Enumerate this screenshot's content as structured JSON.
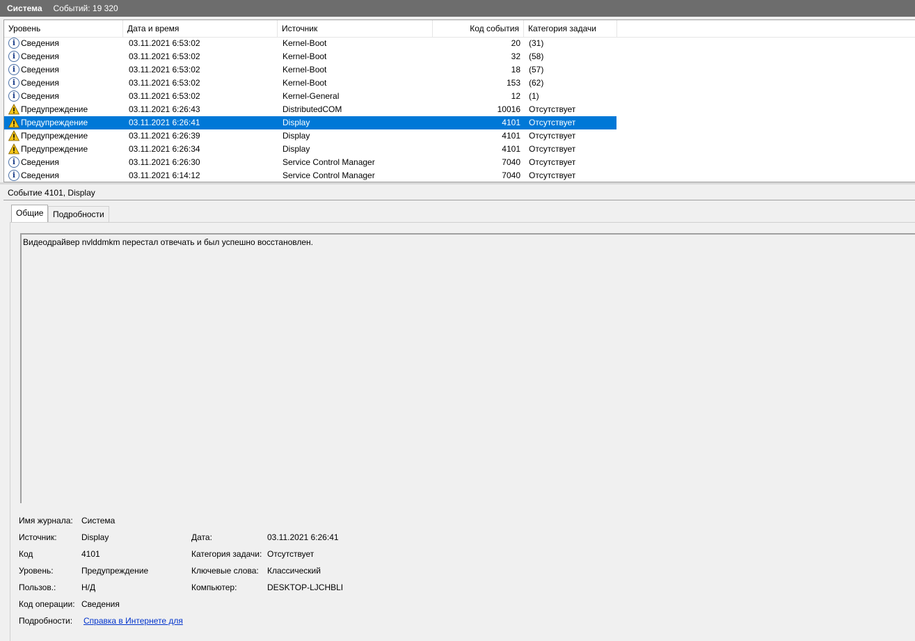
{
  "titlebar": {
    "log_name": "Система",
    "event_count": "Событий: 19 320"
  },
  "columns": {
    "level": "Уровень",
    "datetime": "Дата и время",
    "source": "Источник",
    "event_code": "Код события",
    "task_category": "Категория задачи"
  },
  "events": [
    {
      "level": "Сведения",
      "icon": "info-icon",
      "datetime": "03.11.2021 6:53:02",
      "source": "Kernel-Boot",
      "code": "20",
      "category": "(31)"
    },
    {
      "level": "Сведения",
      "icon": "info-icon",
      "datetime": "03.11.2021 6:53:02",
      "source": "Kernel-Boot",
      "code": "32",
      "category": "(58)"
    },
    {
      "level": "Сведения",
      "icon": "info-icon",
      "datetime": "03.11.2021 6:53:02",
      "source": "Kernel-Boot",
      "code": "18",
      "category": "(57)"
    },
    {
      "level": "Сведения",
      "icon": "info-icon",
      "datetime": "03.11.2021 6:53:02",
      "source": "Kernel-Boot",
      "code": "153",
      "category": "(62)"
    },
    {
      "level": "Сведения",
      "icon": "info-icon",
      "datetime": "03.11.2021 6:53:02",
      "source": "Kernel-General",
      "code": "12",
      "category": "(1)"
    },
    {
      "level": "Предупреждение",
      "icon": "warning-icon",
      "datetime": "03.11.2021 6:26:43",
      "source": "DistributedCOM",
      "code": "10016",
      "category": "Отсутствует"
    },
    {
      "level": "Предупреждение",
      "icon": "warning-icon",
      "datetime": "03.11.2021 6:26:41",
      "source": "Display",
      "code": "4101",
      "category": "Отсутствует",
      "selected": true
    },
    {
      "level": "Предупреждение",
      "icon": "warning-icon",
      "datetime": "03.11.2021 6:26:39",
      "source": "Display",
      "code": "4101",
      "category": "Отсутствует"
    },
    {
      "level": "Предупреждение",
      "icon": "warning-icon",
      "datetime": "03.11.2021 6:26:34",
      "source": "Display",
      "code": "4101",
      "category": "Отсутствует"
    },
    {
      "level": "Сведения",
      "icon": "info-icon",
      "datetime": "03.11.2021 6:26:30",
      "source": "Service Control Manager",
      "code": "7040",
      "category": "Отсутствует"
    },
    {
      "level": "Сведения",
      "icon": "info-icon",
      "datetime": "03.11.2021 6:14:12",
      "source": "Service Control Manager",
      "code": "7040",
      "category": "Отсутствует"
    }
  ],
  "detail": {
    "title": "Событие 4101, Display",
    "tabs": [
      "Общие",
      "Подробности"
    ],
    "message": "Видеодрайвер nvlddmkm перестал отвечать и был успешно восстановлен.",
    "labels": {
      "log_name": "Имя журнала:",
      "source": "Источник:",
      "code": "Код",
      "level": "Уровень:",
      "user": "Пользов.:",
      "opcode": "Код операции:",
      "more_info": "Подробности:",
      "date": "Дата:",
      "task_category": "Категория задачи:",
      "keywords": "Ключевые слова:",
      "computer": "Компьютер:"
    },
    "values": {
      "log_name": "Система",
      "source": "Display",
      "code": "4101",
      "level": "Предупреждение",
      "user": "Н/Д",
      "opcode": "Сведения",
      "more_info_link": "Справка в Интернете для ",
      "date": "03.11.2021 6:26:41",
      "task_category": "Отсутствует",
      "keywords": "Классический",
      "computer": "DESKTOP-LJCHBLI"
    }
  },
  "colors": {
    "selection": "#0078d7",
    "titlebar": "#6d6d6d",
    "link": "#0033cc",
    "warning": "#f5c518"
  }
}
